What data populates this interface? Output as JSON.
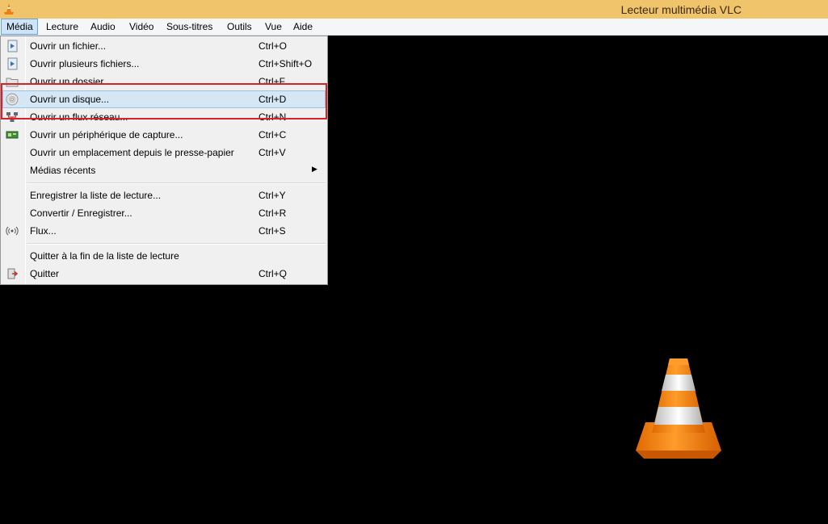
{
  "window": {
    "title": "Lecteur multimédia VLC",
    "app_icon": "vlc-cone-icon"
  },
  "menubar": {
    "items": [
      "Média",
      "Lecture",
      "Audio",
      "Vidéo",
      "Sous-titres",
      "Outils",
      "Vue",
      "Aide"
    ],
    "active": "Média"
  },
  "media_menu": {
    "items": [
      {
        "label": "Ouvrir un fichier...",
        "shortcut": "Ctrl+O",
        "icon": "play-file-icon"
      },
      {
        "label": "Ouvrir plusieurs fichiers...",
        "shortcut": "Ctrl+Shift+O",
        "icon": "play-file-icon"
      },
      {
        "label": "Ouvrir un dossier...",
        "shortcut": "Ctrl+F",
        "icon": "folder-icon"
      },
      {
        "label": "Ouvrir un disque...",
        "shortcut": "Ctrl+D",
        "icon": "disc-icon"
      },
      {
        "label": "Ouvrir un flux réseau...",
        "shortcut": "Ctrl+N",
        "icon": "network-icon"
      },
      {
        "label": "Ouvrir un périphérique de capture...",
        "shortcut": "Ctrl+C",
        "icon": "capture-card-icon"
      },
      {
        "label": "Ouvrir un emplacement depuis le presse-papier",
        "shortcut": "Ctrl+V",
        "icon": ""
      },
      {
        "label": "Médias récents",
        "shortcut": "",
        "icon": ""
      },
      {
        "label": "Enregistrer la liste de lecture...",
        "shortcut": "Ctrl+Y",
        "icon": ""
      },
      {
        "label": "Convertir / Enregistrer...",
        "shortcut": "Ctrl+R",
        "icon": ""
      },
      {
        "label": "Flux...",
        "shortcut": "Ctrl+S",
        "icon": "stream-icon"
      },
      {
        "label": "Quitter à la fin de la liste de lecture",
        "shortcut": "",
        "icon": ""
      },
      {
        "label": "Quitter",
        "shortcut": "Ctrl+Q",
        "icon": "quit-icon"
      }
    ],
    "highlighted": "Ouvrir un disque...",
    "annotation_color": "#d4232a"
  },
  "colors": {
    "titlebar": "#f0c46a",
    "video_area": "#000000",
    "highlight": "#d5e6f5",
    "cone_orange": "#f07d10"
  }
}
